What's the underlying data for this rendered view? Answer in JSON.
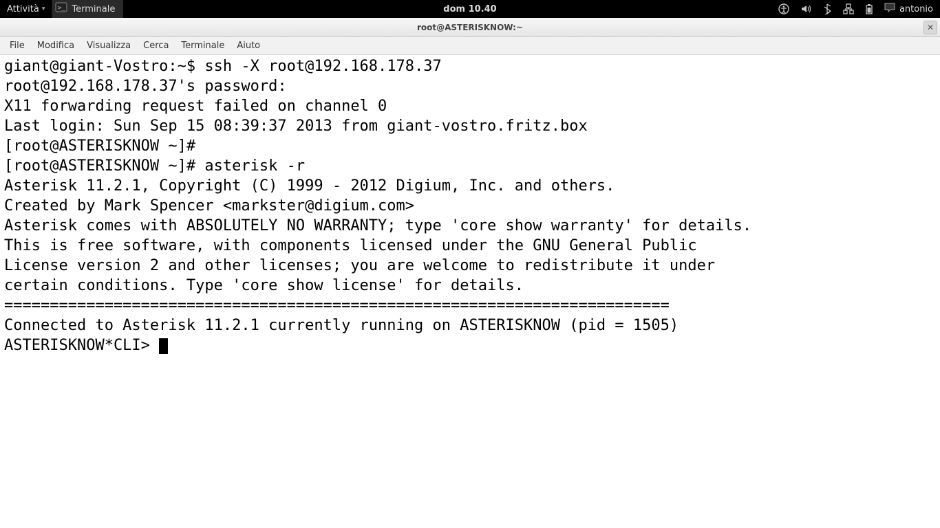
{
  "topbar": {
    "activities_label": "Attività",
    "app_label": "Terminale",
    "clock": "dom 10.40",
    "user": "antonio"
  },
  "window": {
    "title": "root@ASTERISKNOW:~"
  },
  "menubar": {
    "items": [
      "File",
      "Modifica",
      "Visualizza",
      "Cerca",
      "Terminale",
      "Aiuto"
    ]
  },
  "terminal": {
    "lines": [
      "giant@giant-Vostro:~$ ssh -X root@192.168.178.37",
      "root@192.168.178.37's password: ",
      "X11 forwarding request failed on channel 0",
      "Last login: Sun Sep 15 08:39:37 2013 from giant-vostro.fritz.box",
      "[root@ASTERISKNOW ~]# ",
      "[root@ASTERISKNOW ~]# asterisk -r",
      "Asterisk 11.2.1, Copyright (C) 1999 - 2012 Digium, Inc. and others.",
      "Created by Mark Spencer <markster@digium.com>",
      "Asterisk comes with ABSOLUTELY NO WARRANTY; type 'core show warranty' for details.",
      "This is free software, with components licensed under the GNU General Public",
      "License version 2 and other licenses; you are welcome to redistribute it under",
      "certain conditions. Type 'core show license' for details.",
      "=========================================================================",
      "Connected to Asterisk 11.2.1 currently running on ASTERISKNOW (pid = 1505)"
    ],
    "prompt": "ASTERISKNOW*CLI> "
  }
}
